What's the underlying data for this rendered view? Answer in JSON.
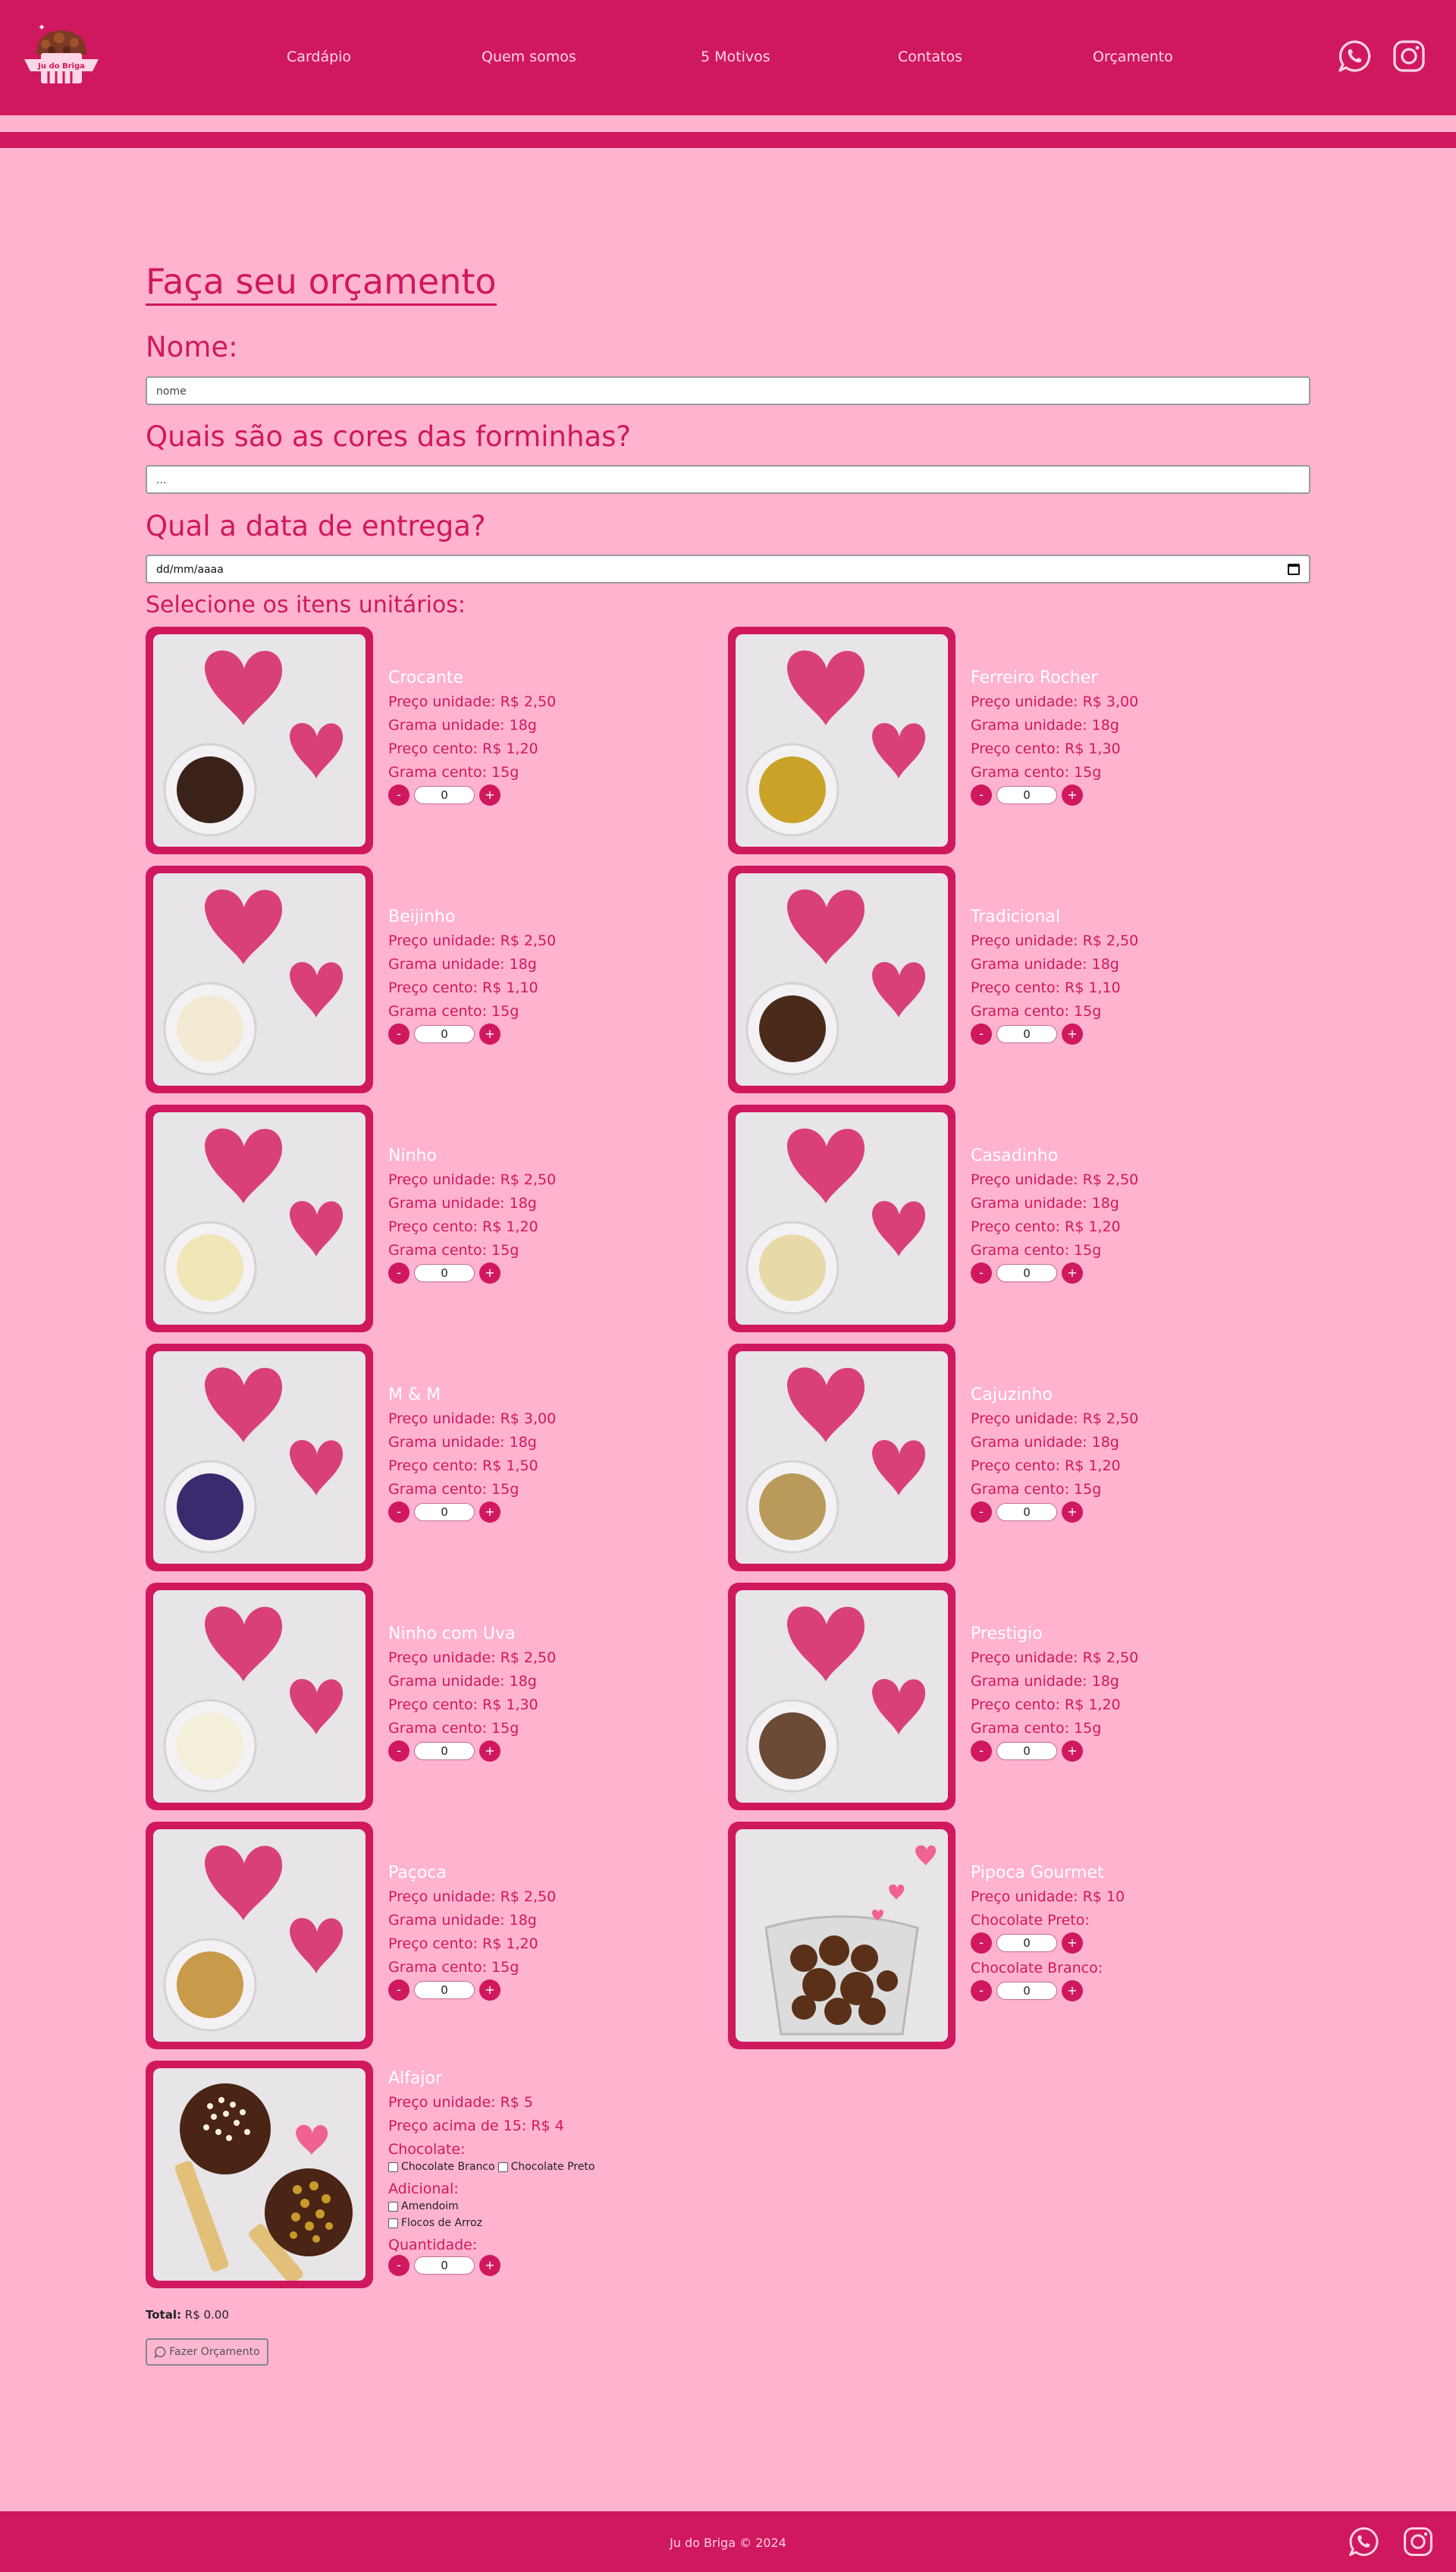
{
  "header": {
    "logo_text": "Ju do Briga",
    "nav": [
      "Cardápio",
      "Quem somos",
      "5 Motivos",
      "Contatos",
      "Orçamento"
    ],
    "icons": [
      "whatsapp-icon",
      "instagram-icon"
    ]
  },
  "form": {
    "title": "Faça seu orçamento",
    "name_label": "Nome:",
    "name_placeholder": "nome",
    "colors_label": "Quais são as cores das forminhas?",
    "colors_placeholder": "...",
    "date_label": "Qual a data de entrega?",
    "date_placeholder": "dd/mm/aaaa",
    "items_label": "Selecione os itens unitários:"
  },
  "products": [
    {
      "name": "Crocante",
      "price_unit": "Preço unidade: R$ 2,50",
      "gram_unit": "Grama unidade: 18g",
      "price_cento": "Preço cento: R$ 1,20",
      "gram_cento": "Grama cento: 15g",
      "qty": "0"
    },
    {
      "name": "Ferreiro Rocher",
      "price_unit": "Preço unidade: R$ 3,00",
      "gram_unit": "Grama unidade: 18g",
      "price_cento": "Preço cento: R$ 1,30",
      "gram_cento": "Grama cento: 15g",
      "qty": "0"
    },
    {
      "name": "Beijinho",
      "price_unit": "Preço unidade: R$ 2,50",
      "gram_unit": "Grama unidade: 18g",
      "price_cento": "Preço cento: R$ 1,10",
      "gram_cento": "Grama cento: 15g",
      "qty": "0"
    },
    {
      "name": "Tradicional",
      "price_unit": "Preço unidade: R$ 2,50",
      "gram_unit": "Grama unidade: 18g",
      "price_cento": "Preço cento: R$ 1,10",
      "gram_cento": "Grama cento: 15g",
      "qty": "0"
    },
    {
      "name": "Ninho",
      "price_unit": "Preço unidade: R$ 2,50",
      "gram_unit": "Grama unidade: 18g",
      "price_cento": "Preço cento: R$ 1,20",
      "gram_cento": "Grama cento: 15g",
      "qty": "0"
    },
    {
      "name": "Casadinho",
      "price_unit": "Preço unidade: R$ 2,50",
      "gram_unit": "Grama unidade: 18g",
      "price_cento": "Preço cento: R$ 1,20",
      "gram_cento": "Grama cento: 15g",
      "qty": "0"
    },
    {
      "name": "M & M",
      "price_unit": "Preço unidade: R$ 3,00",
      "gram_unit": "Grama unidade: 18g",
      "price_cento": "Preço cento: R$ 1,50",
      "gram_cento": "Grama cento: 15g",
      "qty": "0"
    },
    {
      "name": "Cajuzinho",
      "price_unit": "Preço unidade: R$ 2,50",
      "gram_unit": "Grama unidade: 18g",
      "price_cento": "Preço cento: R$ 1,20",
      "gram_cento": "Grama cento: 15g",
      "qty": "0"
    },
    {
      "name": "Ninho com Uva",
      "price_unit": "Preço unidade: R$ 2,50",
      "gram_unit": "Grama unidade: 18g",
      "price_cento": "Preço cento: R$ 1,30",
      "gram_cento": "Grama cento: 15g",
      "qty": "0"
    },
    {
      "name": "Prestigio",
      "price_unit": "Preço unidade: R$ 2,50",
      "gram_unit": "Grama unidade: 18g",
      "price_cento": "Preço cento: R$ 1,20",
      "gram_cento": "Grama cento: 15g",
      "qty": "0"
    },
    {
      "name": "Paçoca",
      "price_unit": "Preço unidade: R$ 2,50",
      "gram_unit": "Grama unidade: 18g",
      "price_cento": "Preço cento: R$ 1,20",
      "gram_cento": "Grama cento: 15g",
      "qty": "0"
    }
  ],
  "pipoca": {
    "name": "Pipoca Gourmet",
    "price_unit": "Preço unidade: R$ 10",
    "choc_preto_label": "Chocolate Preto:",
    "choc_preto_qty": "0",
    "choc_branco_label": "Chocolate Branco:",
    "choc_branco_qty": "0"
  },
  "alfajor": {
    "name": "Alfajor",
    "price_unit": "Preço unidade: R$ 5",
    "price_15": "Preço acima de 15: R$ 4",
    "chocolate_label": "Chocolate:",
    "choc_branco": "Chocolate Branco",
    "choc_preto": "Chocolate Preto",
    "adicional_label": "Adicional:",
    "amendoim": "Amendoim",
    "flocos": "Flocos de Arroz",
    "quantidade_label": "Quantidade:",
    "qty": "0"
  },
  "summary": {
    "total_label": "Total:",
    "total_value": "R$ 0.00",
    "button_label": "Fazer Orçamento"
  },
  "footer": {
    "copyright": "Ju do Briga © 2024"
  },
  "colors": {
    "brand": "#d0185e",
    "background": "#ffb3cf"
  }
}
